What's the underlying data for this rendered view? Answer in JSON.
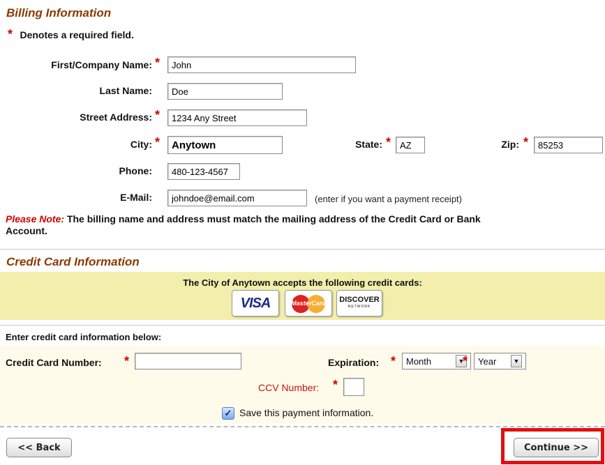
{
  "billing": {
    "title": "Billing Information",
    "required_note": "Denotes a required field.",
    "first_label": "First/Company Name:",
    "first_value": "John",
    "last_label": "Last Name:",
    "last_value": "Doe",
    "street_label": "Street Address:",
    "street_value": "1234 Any Street",
    "city_label": "City:",
    "city_value": "Anytown",
    "state_label": "State:",
    "state_value": "AZ",
    "zip_label": "Zip:",
    "zip_value": "85253",
    "phone_label": "Phone:",
    "phone_value": "480-123-4567",
    "email_label": "E-Mail:",
    "email_value": "johndoe@email.com",
    "email_hint": "(enter if you want a payment receipt)"
  },
  "note": {
    "prefix": "Please Note:",
    "text": "The billing name and address must match the mailing address of the Credit Card or Bank",
    "text2": "Account."
  },
  "credit": {
    "title": "Credit Card Information",
    "accepts": "The City of Anytown accepts the following credit cards:",
    "cards": {
      "visa": "VISA",
      "mastercard": "MasterCard",
      "discover": "DISCOVER",
      "discover_sub": "NETWORK"
    },
    "enter_label": "Enter credit card information below:",
    "number_label": "Credit Card Number:",
    "number_value": "",
    "expiration_label": "Expiration:",
    "month_value": "Month",
    "year_value": "Year",
    "ccv_label": "CCV Number:",
    "ccv_value": "",
    "save_label": "Save this payment information.",
    "save_checked": true
  },
  "buttons": {
    "back": "<< Back",
    "continue": "Continue >>"
  },
  "colors": {
    "section_title": "#8b3a00",
    "required": "#d10000",
    "cc_band": "#f2efad",
    "form_band": "#fefbea",
    "highlight": "#e01010"
  }
}
